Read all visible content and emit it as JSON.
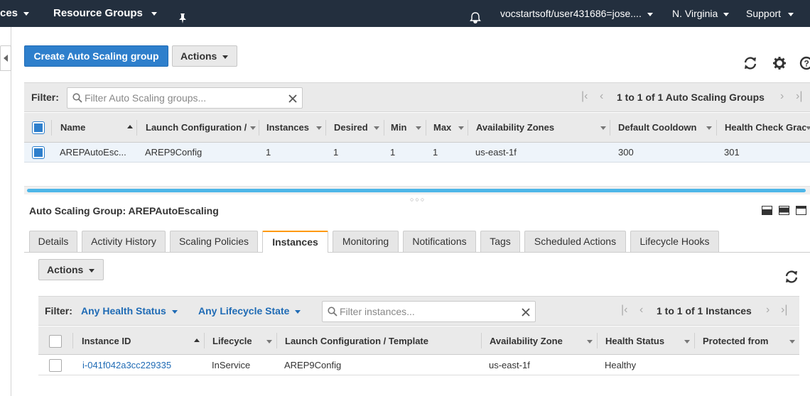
{
  "topnav": {
    "services": "ces",
    "resource_groups": "Resource Groups",
    "account": "vocstartsoft/user431686=jose....",
    "region": "N. Virginia",
    "support": "Support"
  },
  "toolbar": {
    "create_label": "Create Auto Scaling group",
    "actions_label": "Actions"
  },
  "groups_filter": {
    "label": "Filter:",
    "placeholder": "Filter Auto Scaling groups...",
    "pagination": "1 to 1 of 1 Auto Scaling Groups"
  },
  "groups_table": {
    "columns": [
      "Name",
      "Launch Configuration /",
      "Instances",
      "Desired",
      "Min",
      "Max",
      "Availability Zones",
      "Default Cooldown",
      "Health Check Grac"
    ],
    "rows": [
      [
        "AREPAutoEsc...",
        "AREP9Config",
        "1",
        "1",
        "1",
        "1",
        "us-east-1f",
        "300",
        "301"
      ]
    ]
  },
  "detail": {
    "title": "Auto Scaling Group: AREPAutoEscaling",
    "tabs": [
      "Details",
      "Activity History",
      "Scaling Policies",
      "Instances",
      "Monitoring",
      "Notifications",
      "Tags",
      "Scheduled Actions",
      "Lifecycle Hooks"
    ],
    "active_tab": "Instances",
    "actions_label": "Actions"
  },
  "instances_filter": {
    "label": "Filter:",
    "health": "Any Health Status",
    "lifecycle": "Any Lifecycle State",
    "placeholder": "Filter instances...",
    "pagination": "1 to 1 of 1 Instances"
  },
  "instances_table": {
    "columns": [
      "Instance ID",
      "Lifecycle",
      "Launch Configuration / Template",
      "Availability Zone",
      "Health Status",
      "Protected from"
    ],
    "rows": [
      [
        "i-041f042a3cc229335",
        "InService",
        "AREP9Config",
        "us-east-1f",
        "Healthy",
        ""
      ]
    ]
  },
  "colors": {
    "nav": "#232f3e",
    "primary": "#2e7fcc",
    "link": "#1f6bb5",
    "active_tab": "#ff9900",
    "progress": "#4db6e8"
  }
}
